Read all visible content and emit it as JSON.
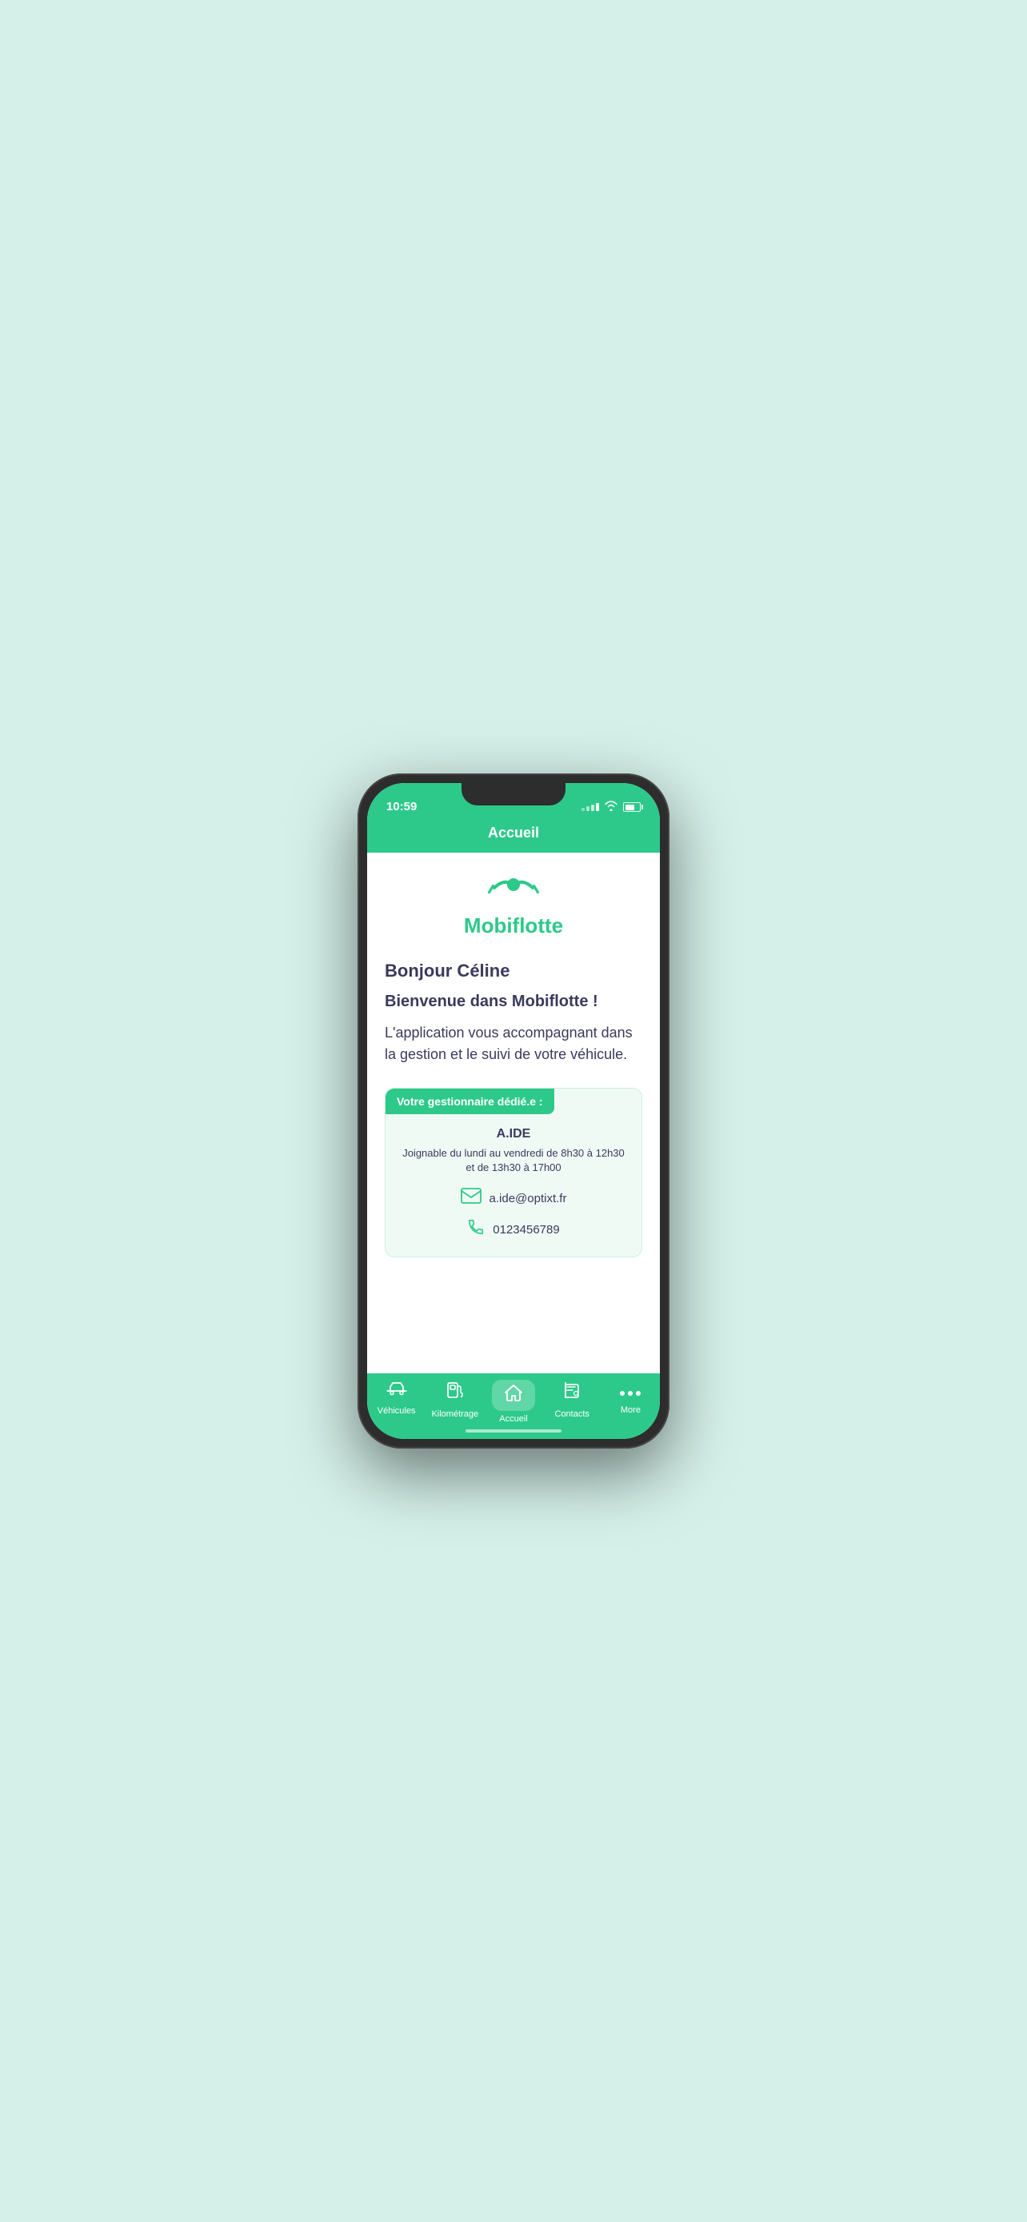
{
  "status_bar": {
    "time": "10:59",
    "wifi": true,
    "battery": true
  },
  "header": {
    "title": "Accueil"
  },
  "logo": {
    "brand_name": "Mobiflotte"
  },
  "content": {
    "greeting": "Bonjour Céline",
    "welcome": "Bienvenue dans Mobiflotte !",
    "description": "L'application vous accompagnant dans la gestion et le suivi de votre véhicule.",
    "manager_label": "Votre gestionnaire dédié.e :",
    "manager_name": "A.IDE",
    "manager_hours": "Joignable du lundi au vendredi de 8h30 à 12h30 et de 13h30 à 17h00",
    "manager_email": "a.ide@optixt.fr",
    "manager_phone": "0123456789"
  },
  "bottom_nav": {
    "items": [
      {
        "id": "vehicules",
        "label": "Véhicules",
        "active": false
      },
      {
        "id": "kilometrage",
        "label": "Kilométrage",
        "active": false
      },
      {
        "id": "accueil",
        "label": "Accueil",
        "active": true
      },
      {
        "id": "contacts",
        "label": "Contacts",
        "active": false
      },
      {
        "id": "more",
        "label": "More",
        "active": false
      }
    ]
  },
  "colors": {
    "primary": "#2dc98a",
    "text_dark": "#3a3a5c",
    "bg_light": "#f0faf5"
  }
}
